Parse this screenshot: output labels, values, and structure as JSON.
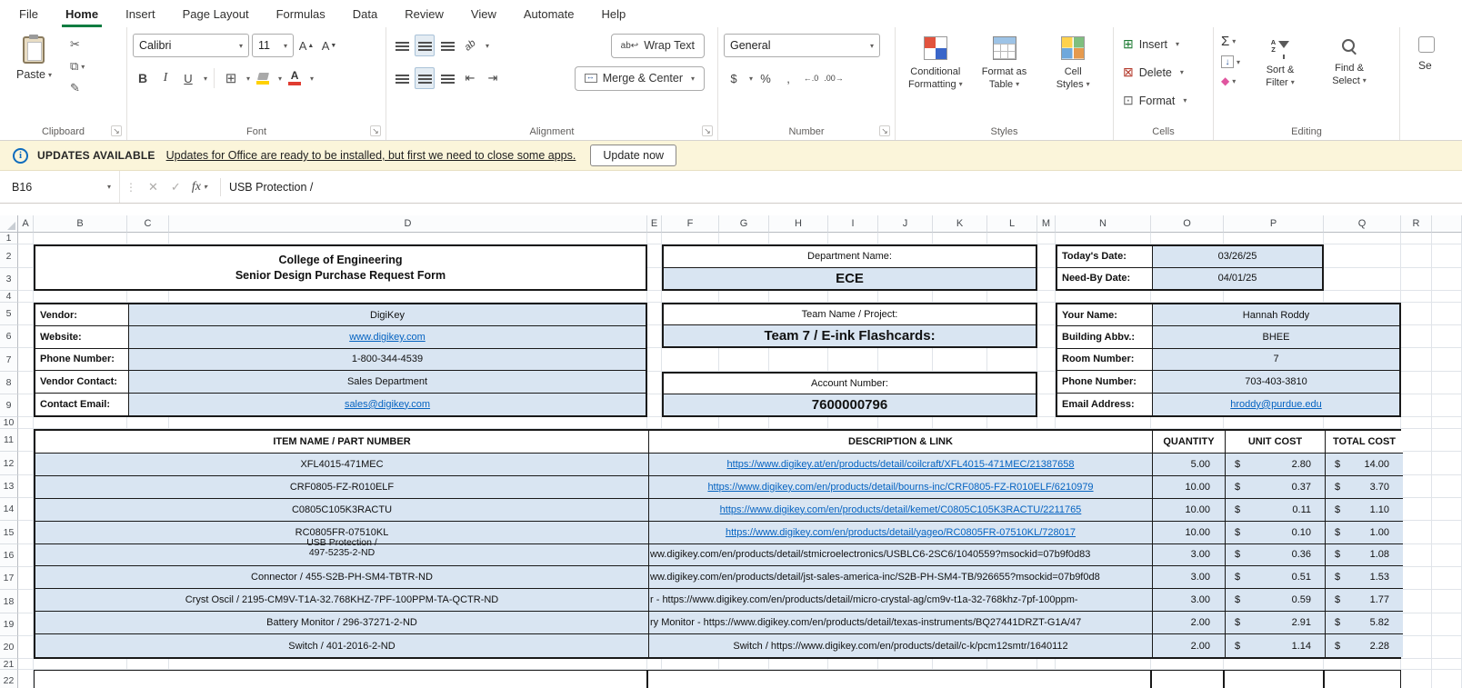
{
  "colors": {
    "excel_green": "#107c41",
    "cell_fill_blue": "#d9e5f2",
    "link_blue": "#0563c1",
    "notification_yellow": "#fbf5da"
  },
  "app": {
    "menu_items": [
      "File",
      "Home",
      "Insert",
      "Page Layout",
      "Formulas",
      "Data",
      "Review",
      "View",
      "Automate",
      "Help"
    ],
    "active_menu": "Home"
  },
  "ribbon": {
    "groups": {
      "clipboard": "Clipboard",
      "font": "Font",
      "alignment": "Alignment",
      "number": "Number",
      "styles": "Styles",
      "cells": "Cells",
      "editing": "Editing"
    },
    "paste": "Paste",
    "font_name": "Calibri",
    "font_size": "11",
    "wrap_text": "Wrap Text",
    "merge_center": "Merge & Center",
    "number_format": "General",
    "conditional_formatting_1": "Conditional",
    "conditional_formatting_2": "Formatting",
    "format_as_table_1": "Format as",
    "format_as_table_2": "Table",
    "cell_styles_1": "Cell",
    "cell_styles_2": "Styles",
    "insert": "Insert",
    "delete": "Delete",
    "format": "Format",
    "sort_filter_1": "Sort &",
    "sort_filter_2": "Filter",
    "find_select_1": "Find &",
    "find_select_2": "Select",
    "sensitivity_partial": "Se"
  },
  "notification": {
    "badge": "UPDATES AVAILABLE",
    "message": "Updates for Office are ready to be installed, but first we need to close some apps.",
    "action": "Update now"
  },
  "formula_bar": {
    "name_box": "B16",
    "fx": "fx",
    "content": "USB Protection /"
  },
  "sheet": {
    "columns": [
      "A",
      "B",
      "C",
      "D",
      "E",
      "F",
      "G",
      "H",
      "I",
      "J",
      "K",
      "L",
      "M",
      "N",
      "O",
      "P",
      "Q",
      "R"
    ],
    "visible_rows": 22,
    "title_line1": "College of Engineering",
    "title_line2": "Senior Design Purchase Request Form",
    "vendor_form": [
      {
        "label": "Vendor:",
        "value": "DigiKey",
        "link": false
      },
      {
        "label": "Website:",
        "value": "www.digikey.com",
        "link": true
      },
      {
        "label": "Phone Number:",
        "value": "1-800-344-4539",
        "link": false
      },
      {
        "label": "Vendor Contact:",
        "value": "Sales Department",
        "link": false
      },
      {
        "label": "Contact Email:",
        "value": "sales@digikey.com",
        "link": true
      }
    ],
    "center_blocks": [
      {
        "label": "Department Name:",
        "value": "ECE"
      },
      {
        "label": "Team Name / Project:",
        "value": "Team 7 / E-ink Flashcards:"
      },
      {
        "label": "Account Number:",
        "value": "7600000796"
      }
    ],
    "date_form": [
      {
        "label": "Today's Date:",
        "value": "03/26/25",
        "link": false
      },
      {
        "label": "Need-By Date:",
        "value": "04/01/25",
        "link": false
      }
    ],
    "person_form": [
      {
        "label": "Your Name:",
        "value": "Hannah Roddy",
        "link": false
      },
      {
        "label": "Building Abbv.:",
        "value": "BHEE",
        "link": false
      },
      {
        "label": "Room Number:",
        "value": "7",
        "link": false
      },
      {
        "label": "Phone Number:",
        "value": "703-403-3810",
        "link": false
      },
      {
        "label": "Email Address:",
        "value": "hroddy@purdue.edu",
        "link": true
      }
    ],
    "item_table": {
      "headers": [
        "ITEM NAME / PART NUMBER",
        "DESCRIPTION & LINK",
        "QUANTITY",
        "UNIT COST",
        "TOTAL COST"
      ],
      "currency": "$",
      "rows": [
        {
          "name": "XFL4015-471MEC",
          "name2": "",
          "desc": "https://www.digikey.at/en/products/detail/coilcraft/XFL4015-471MEC/21387658",
          "desc_style": "link",
          "qty": "5.00",
          "unit": "2.80",
          "total": "14.00"
        },
        {
          "name": "CRF0805-FZ-R010ELF",
          "name2": "",
          "desc": "https://www.digikey.com/en/products/detail/bourns-inc/CRF0805-FZ-R010ELF/6210979",
          "desc_style": "link",
          "qty": "10.00",
          "unit": "0.37",
          "total": "3.70"
        },
        {
          "name": "C0805C105K3RACTU",
          "name2": "",
          "desc": "https://www.digikey.com/en/products/detail/kemet/C0805C105K3RACTU/2211765",
          "desc_style": "link",
          "qty": "10.00",
          "unit": "0.11",
          "total": "1.10"
        },
        {
          "name": "RC0805FR-07510KL",
          "name2": "",
          "desc": "https://www.digikey.com/en/products/detail/yageo/RC0805FR-07510KL/728017",
          "desc_style": "link",
          "qty": "10.00",
          "unit": "0.10",
          "total": "1.00"
        },
        {
          "name": "USB Protection /",
          "name2": "497-5235-2-ND",
          "desc": "ww.digikey.com/en/products/detail/stmicroelectronics/USBLC6-2SC6/1040559?msockid=07b9f0d83",
          "desc_style": "clip",
          "qty": "3.00",
          "unit": "0.36",
          "total": "1.08"
        },
        {
          "name": "Connector / 455-S2B-PH-SM4-TBTR-ND",
          "name2": "",
          "desc": "ww.digikey.com/en/products/detail/jst-sales-america-inc/S2B-PH-SM4-TB/926655?msockid=07b9f0d8",
          "desc_style": "clip",
          "qty": "3.00",
          "unit": "0.51",
          "total": "1.53"
        },
        {
          "name": "Cryst Oscil / 2195-CM9V-T1A-32.768KHZ-7PF-100PPM-TA-QCTR-ND",
          "name2": "",
          "desc": "r - https://www.digikey.com/en/products/detail/micro-crystal-ag/cm9v-t1a-32-768khz-7pf-100ppm-",
          "desc_style": "clip",
          "qty": "3.00",
          "unit": "0.59",
          "total": "1.77"
        },
        {
          "name": "Battery Monitor / 296-37271-2-ND",
          "name2": "",
          "desc": "ry Monitor - https://www.digikey.com/en/products/detail/texas-instruments/BQ27441DRZT-G1A/47",
          "desc_style": "clip",
          "qty": "2.00",
          "unit": "2.91",
          "total": "5.82"
        },
        {
          "name": "Switch / 401-2016-2-ND",
          "name2": "",
          "desc": "Switch / https://www.digikey.com/en/products/detail/c-k/pcm12smtr/1640112",
          "desc_style": "plain",
          "qty": "2.00",
          "unit": "1.14",
          "total": "2.28"
        }
      ]
    }
  }
}
